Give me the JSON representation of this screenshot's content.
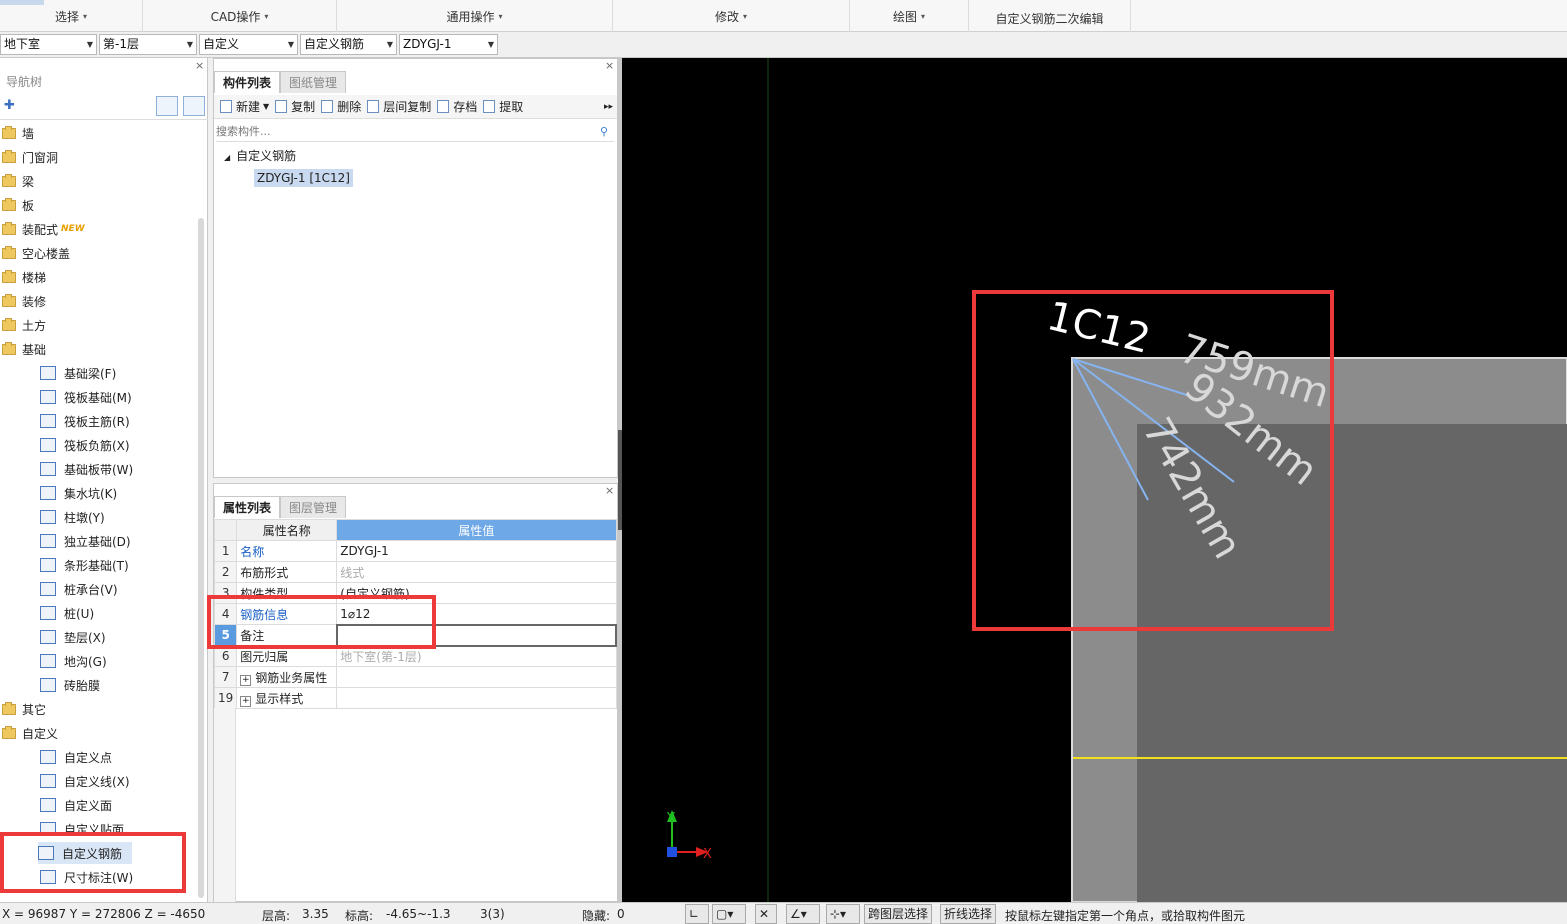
{
  "ribbon": {
    "groups": [
      {
        "label": "选择",
        "arrow": "▾"
      },
      {
        "label": "CAD操作",
        "arrow": "▾"
      },
      {
        "label": "通用操作",
        "arrow": "▾"
      },
      {
        "label": "修改",
        "arrow": "▾"
      },
      {
        "label": "绘图",
        "arrow": "▾"
      },
      {
        "label": "自定义钢筋二次编辑",
        "arrow": ""
      }
    ]
  },
  "selectors": {
    "floor_type": "地下室",
    "floor": "第-1层",
    "category": "自定义",
    "type": "自定义钢筋",
    "component": "ZDYGJ-1"
  },
  "nav": {
    "title": "导航树",
    "new_badge": "NEW",
    "folders": [
      {
        "label": "墙"
      },
      {
        "label": "门窗洞"
      },
      {
        "label": "梁"
      },
      {
        "label": "板"
      },
      {
        "label": "装配式"
      },
      {
        "label": "空心楼盖"
      },
      {
        "label": "楼梯"
      },
      {
        "label": "装修"
      },
      {
        "label": "土方"
      },
      {
        "label": "基础"
      }
    ],
    "foundation_children": [
      {
        "label": "基础梁(F)"
      },
      {
        "label": "筏板基础(M)"
      },
      {
        "label": "筏板主筋(R)"
      },
      {
        "label": "筏板负筋(X)"
      },
      {
        "label": "基础板带(W)"
      },
      {
        "label": "集水坑(K)"
      },
      {
        "label": "柱墩(Y)"
      },
      {
        "label": "独立基础(D)"
      },
      {
        "label": "条形基础(T)"
      },
      {
        "label": "桩承台(V)"
      },
      {
        "label": "桩(U)"
      },
      {
        "label": "垫层(X)"
      },
      {
        "label": "地沟(G)"
      },
      {
        "label": "砖胎膜"
      }
    ],
    "other_folders": [
      {
        "label": "其它"
      },
      {
        "label": "自定义"
      }
    ],
    "custom_children": [
      {
        "label": "自定义点"
      },
      {
        "label": "自定义线(X)"
      },
      {
        "label": "自定义面"
      },
      {
        "label": "自定义贴面"
      },
      {
        "label": "自定义钢筋"
      },
      {
        "label": "尺寸标注(W)"
      }
    ]
  },
  "component_list": {
    "tabs": [
      "构件列表",
      "图纸管理"
    ],
    "toolbar": [
      "新建",
      "复制",
      "删除",
      "层间复制",
      "存档",
      "提取"
    ],
    "more": "▸▸",
    "search_placeholder": "搜索构件...",
    "tree_root": "自定义钢筋",
    "tree_item": "ZDYGJ-1 [1C12]"
  },
  "properties": {
    "tabs": [
      "属性列表",
      "图层管理"
    ],
    "header_name": "属性名称",
    "header_value": "属性值",
    "rows": [
      {
        "num": "1",
        "name": "名称",
        "value": "ZDYGJ-1"
      },
      {
        "num": "2",
        "name": "布筋形式",
        "value": "线式"
      },
      {
        "num": "3",
        "name": "构件类型",
        "value": "(自定义钢筋)"
      },
      {
        "num": "4",
        "name": "钢筋信息",
        "value": "1⌀12"
      },
      {
        "num": "5",
        "name": "备注",
        "value": ""
      },
      {
        "num": "6",
        "name": "图元归属",
        "value": "地下室(第-1层)"
      },
      {
        "num": "7",
        "name": "钢筋业务属性",
        "value": ""
      },
      {
        "num": "19",
        "name": "显示样式",
        "value": ""
      }
    ]
  },
  "canvas": {
    "background": "#000000",
    "rebar_color": "#86b4f0",
    "axis_line_color": "#f0e020",
    "labels": [
      "1C12",
      "759mm",
      "932mm",
      "742mm"
    ],
    "axis_x": "X",
    "axis_y": "Y"
  },
  "status": {
    "coords": "X = 96987 Y = 272806 Z = -4650",
    "floor_height_label": "层高:",
    "floor_height": "3.35",
    "elevation_label": "标高:",
    "elevation": "-4.65~-1.3",
    "count": "3(3)",
    "hidden_label": "隐藏:",
    "hidden": "0",
    "btn_cross_layer": "跨图层选择",
    "btn_polyline": "折线选择",
    "hint": "按鼠标左键指定第一个角点，或拾取构件图元"
  },
  "accent_colors": {
    "annotation_red": "#ec3a3a",
    "selection_blue": "#5a9be0"
  }
}
